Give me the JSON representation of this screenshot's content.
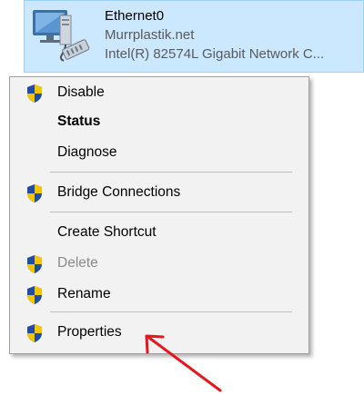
{
  "adapter": {
    "name": "Ethernet0",
    "network": "Murrplastik.net",
    "device": "Intel(R) 82574L Gigabit Network C...",
    "icon": "network-adapter-icon"
  },
  "context_menu": {
    "items": [
      {
        "label": "Disable",
        "icon": "uac-shield-icon",
        "style": "normal"
      },
      {
        "label": "Status",
        "icon": null,
        "style": "bold"
      },
      {
        "label": "Diagnose",
        "icon": null,
        "style": "normal"
      },
      {
        "label": "Bridge Connections",
        "icon": "uac-shield-icon",
        "style": "normal"
      },
      {
        "label": "Create Shortcut",
        "icon": null,
        "style": "normal"
      },
      {
        "label": "Delete",
        "icon": "uac-shield-icon",
        "style": "disabled"
      },
      {
        "label": "Rename",
        "icon": "uac-shield-icon",
        "style": "normal"
      },
      {
        "label": "Properties",
        "icon": "uac-shield-icon",
        "style": "normal"
      }
    ]
  },
  "annotation": {
    "arrow_color": "#e8151b",
    "points_to": "Properties"
  },
  "colors": {
    "selection_bg": "#cce8ff",
    "selection_border": "#99d1ff",
    "menu_bg": "#f2f2f2",
    "shield_blue": "#1f4e9e",
    "shield_yellow": "#f5c400"
  }
}
